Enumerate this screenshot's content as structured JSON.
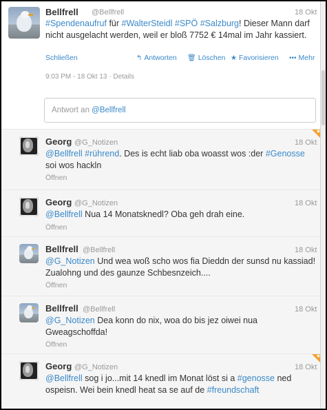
{
  "main_tweet": {
    "name": "Bellfrell",
    "handle": "@Bellfrell",
    "date": "18 Okt",
    "text_parts": [
      {
        "text": "#Spendenaufruf",
        "link": true
      },
      {
        "text": " für ",
        "link": false
      },
      {
        "text": "#WalterSteidl",
        "link": true
      },
      {
        "text": " ",
        "link": false
      },
      {
        "text": "#SPÖ",
        "link": true
      },
      {
        "text": " ",
        "link": false
      },
      {
        "text": "#Salzburg",
        "link": true
      },
      {
        "text": "! Dieser Mann darf nicht ausgelacht werden, weil er bloß 7752 € 14mal im Jahr kassiert.",
        "link": false
      }
    ],
    "close_label": "Schließen",
    "actions": {
      "reply": "Antworten",
      "delete": "Löschen",
      "favorite": "Favorisieren",
      "more": "Mehr"
    },
    "timestamp": "9:03 PM - 18 Okt 13 · Details",
    "reply_placeholder_prefix": "Antwort an ",
    "reply_placeholder_mention": "@Bellfrell"
  },
  "replies": [
    {
      "name": "Georg",
      "handle": "@G_Notizen",
      "date": "18 Okt",
      "avatar": "georg",
      "favorited": true,
      "open_label": "Öffnen",
      "text_parts": [
        {
          "text": "@Bellfrell",
          "link": true
        },
        {
          "text": " ",
          "link": false
        },
        {
          "text": "#rührend",
          "link": true
        },
        {
          "text": ". Des is echt liab oba woasst wos :der ",
          "link": false
        },
        {
          "text": "#Genosse",
          "link": true
        },
        {
          "text": " soi wos hackln",
          "link": false
        }
      ]
    },
    {
      "name": "Georg",
      "handle": "@G_Notizen",
      "date": "18 Okt",
      "avatar": "georg",
      "favorited": false,
      "open_label": "Öffnen",
      "text_parts": [
        {
          "text": "@Bellfrell",
          "link": true
        },
        {
          "text": " Nua 14  Monatsknedl? Oba geh drah eine.",
          "link": false
        }
      ]
    },
    {
      "name": "Bellfrell",
      "handle": "@Bellfrell",
      "date": "18 Okt",
      "avatar": "gull",
      "favorited": false,
      "open_label": "Öffnen",
      "text_parts": [
        {
          "text": "@G_Notizen",
          "link": true
        },
        {
          "text": " Und wea woß scho wos fia Dieddn  der sunsd nu kassiad! Zualohng und des gaunze Schbesnzeich....",
          "link": false
        }
      ]
    },
    {
      "name": "Bellfrell",
      "handle": "@Bellfrell",
      "date": "18 Okt",
      "avatar": "gull",
      "favorited": false,
      "open_label": "Öffnen",
      "text_parts": [
        {
          "text": "@G_Notizen",
          "link": true
        },
        {
          "text": " Dea konn do nix, woa do bis jez oiwei nua Gweagschoffda!",
          "link": false
        }
      ]
    },
    {
      "name": "Georg",
      "handle": "@G_Notizen",
      "date": "18 Okt",
      "avatar": "georg",
      "favorited": true,
      "open_label": "",
      "text_parts": [
        {
          "text": "@Bellfrell",
          "link": true
        },
        {
          "text": " sog i jo...mit 14 knedl im Monat löst si a ",
          "link": false
        },
        {
          "text": "#genosse",
          "link": true
        },
        {
          "text": " ned ospeisn. Wei bein knedl heat sa se auf de ",
          "link": false
        },
        {
          "text": "#freundschaft",
          "link": true
        }
      ]
    }
  ],
  "colors": {
    "link": "#3a89c9",
    "favorite_corner": "#f4a12f",
    "reply_background": "#f5f5f5"
  }
}
